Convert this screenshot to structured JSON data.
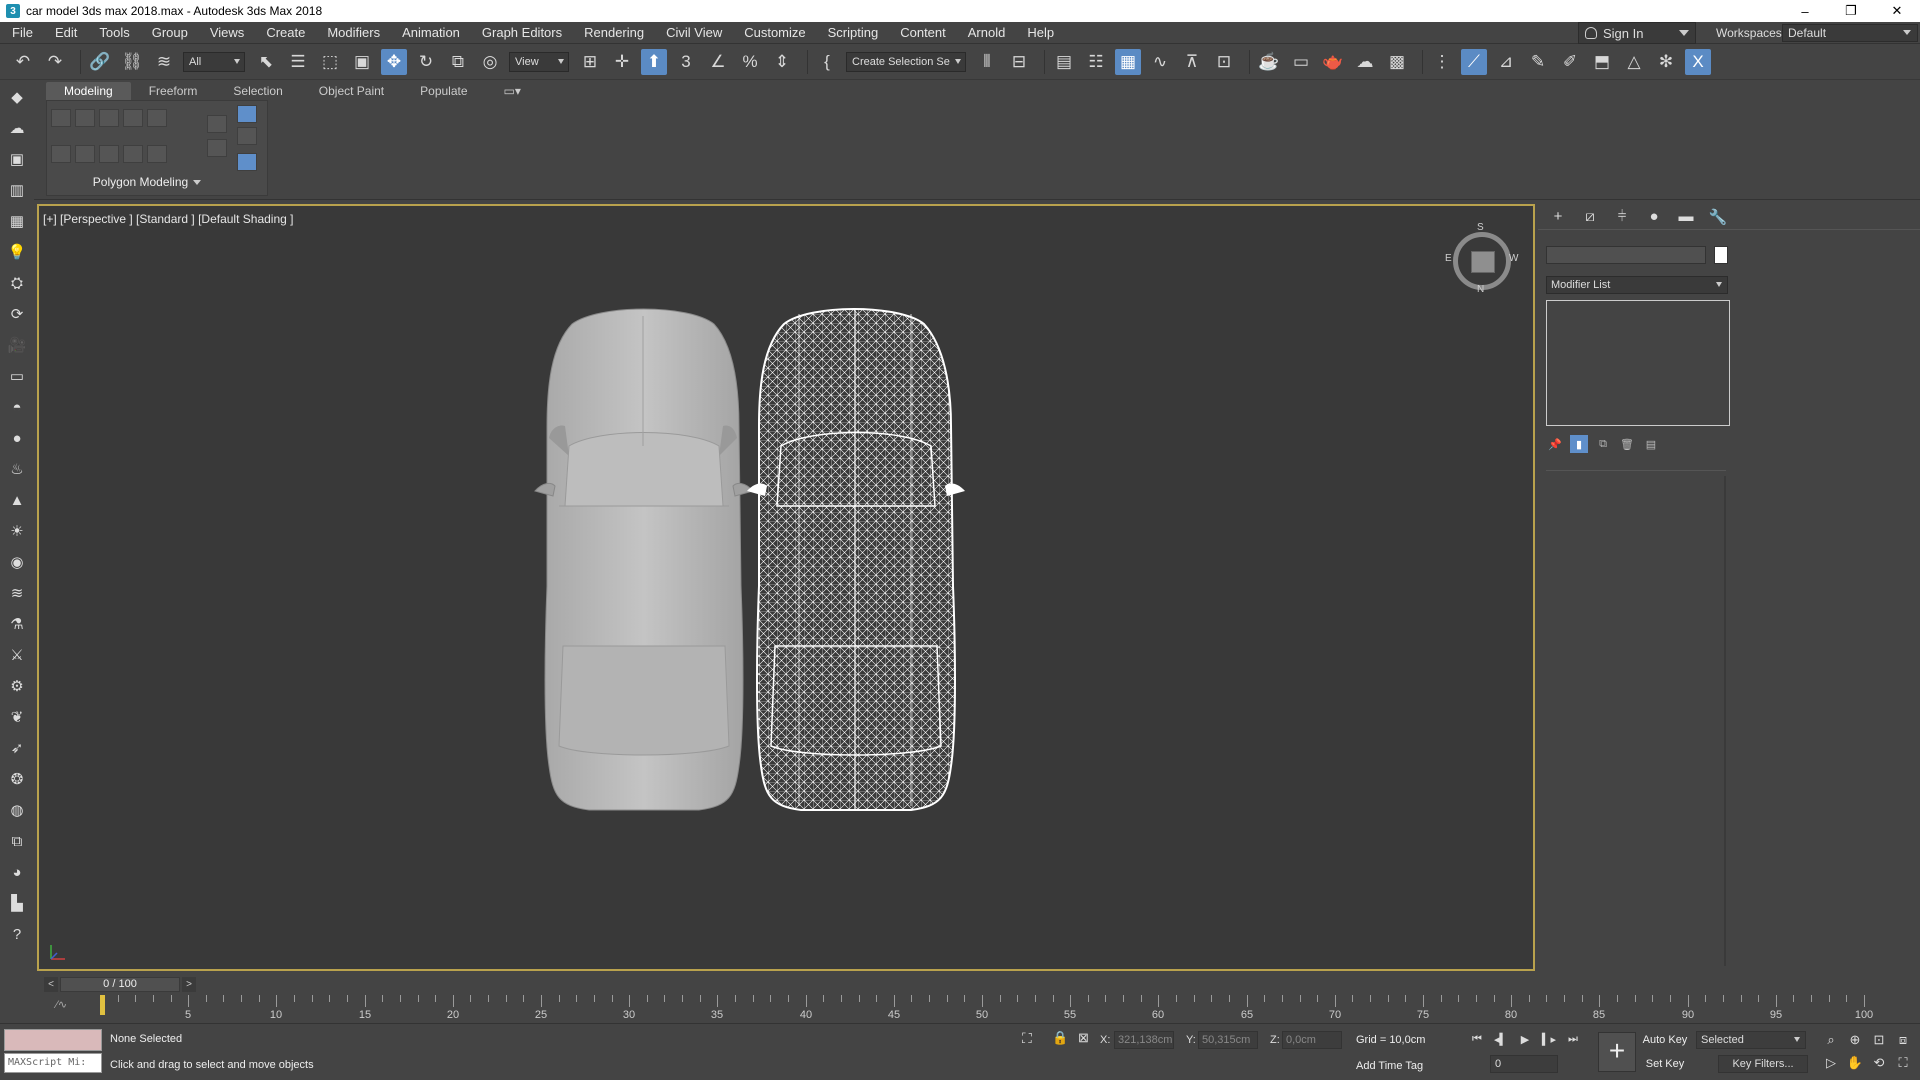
{
  "window": {
    "title": "car model 3ds max 2018.max - Autodesk 3ds Max 2018",
    "app_icon": "3ds-max-icon",
    "controls": [
      "–",
      "❐",
      "✕"
    ]
  },
  "menu": [
    "File",
    "Edit",
    "Tools",
    "Group",
    "Views",
    "Create",
    "Modifiers",
    "Animation",
    "Graph Editors",
    "Rendering",
    "Civil View",
    "Customize",
    "Scripting",
    "Content",
    "Arnold",
    "Help"
  ],
  "account": {
    "sign_in": "Sign In",
    "workspaces_label": "Workspaces:",
    "workspace_value": "Default"
  },
  "toolbar": {
    "selection_filter": "All",
    "reference_coord": "View",
    "named_selection": "Create Selection Se"
  },
  "ribbon": {
    "tabs": [
      "Modeling",
      "Freeform",
      "Selection",
      "Object Paint",
      "Populate"
    ],
    "active_tab": "Modeling",
    "panel_label": "Polygon Modeling"
  },
  "viewport": {
    "label": "[+] [Perspective ] [Standard ] [Default Shading ]",
    "viewcube": {
      "top": "S",
      "bottom": "N",
      "left": "E",
      "right": "W",
      "face": "TOP"
    },
    "border_color": "#b9a24d"
  },
  "command_panel": {
    "tabs": [
      "create-icon",
      "modify-icon",
      "hierarchy-icon",
      "motion-icon",
      "display-icon",
      "utilities-icon"
    ],
    "modifier_list": "Modifier List"
  },
  "timeline": {
    "frame_display": "0 / 100",
    "tick_labels": [
      "5",
      "10",
      "15",
      "20",
      "25",
      "30",
      "35",
      "40",
      "45",
      "50",
      "55",
      "60",
      "65",
      "70",
      "75",
      "80",
      "85",
      "90",
      "95",
      "100"
    ]
  },
  "status": {
    "maxscript_placeholder": "MAXScript Mi:",
    "selection": "None Selected",
    "prompt": "Click and drag to select and move objects",
    "x_label": "X:",
    "x_value": "321,138cm",
    "y_label": "Y:",
    "y_value": "50,315cm",
    "z_label": "Z:",
    "z_value": "0,0cm",
    "grid": "Grid = 10,0cm",
    "add_time_tag": "Add Time Tag",
    "current_frame": "0",
    "auto_key": "Auto Key",
    "set_key": "Set Key",
    "key_mode": "Selected",
    "key_filters": "Key Filters..."
  }
}
